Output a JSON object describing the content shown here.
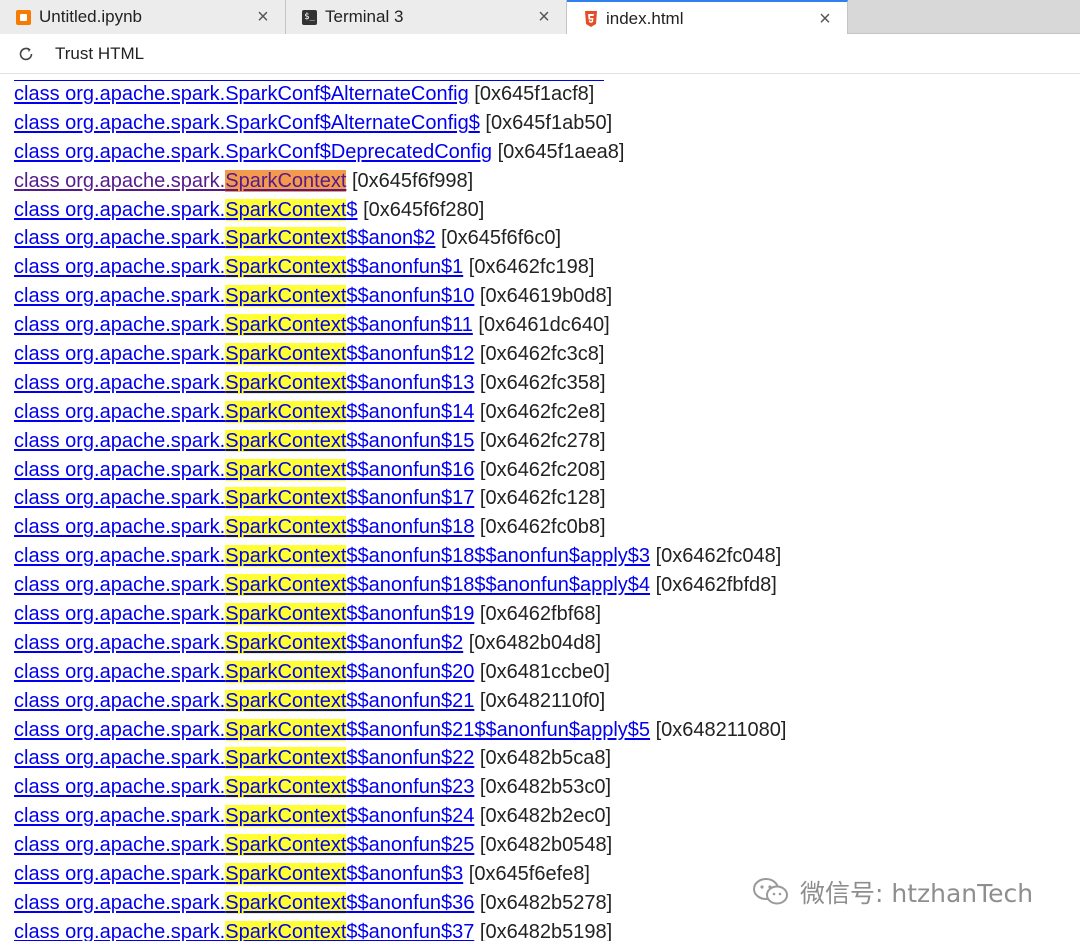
{
  "tabs": [
    {
      "label": "Untitled.ipynb",
      "icon": "notebook-icon",
      "active": false
    },
    {
      "label": "Terminal 3",
      "icon": "terminal-icon",
      "active": false
    },
    {
      "label": "index.html",
      "icon": "html-file-icon",
      "active": true
    }
  ],
  "tab_close_glyph": "×",
  "terminal_icon_glyph": "$_",
  "toolbar": {
    "trust_label": "Trust HTML"
  },
  "rows": [
    {
      "prefix": "class org.apache.spark.SparkConf$AlternateConfig",
      "hl": "",
      "suffix": "",
      "addr": " [0x645f1acf8]"
    },
    {
      "prefix": "class org.apache.spark.SparkConf$AlternateConfig$",
      "hl": "",
      "suffix": "",
      "addr": " [0x645f1ab50]"
    },
    {
      "prefix": "class org.apache.spark.SparkConf$DeprecatedConfig",
      "hl": "",
      "suffix": "",
      "addr": " [0x645f1aea8]"
    },
    {
      "prefix": "class org.apache.spark.",
      "hl": "SparkContext",
      "suffix": "",
      "addr": " [0x645f6f998]",
      "current": true,
      "visited": true
    },
    {
      "prefix": "class org.apache.spark.",
      "hl": "SparkContext",
      "suffix": "$",
      "addr": " [0x645f6f280]"
    },
    {
      "prefix": "class org.apache.spark.",
      "hl": "SparkContext",
      "suffix": "$$anon$2",
      "addr": " [0x645f6f6c0]"
    },
    {
      "prefix": "class org.apache.spark.",
      "hl": "SparkContext",
      "suffix": "$$anonfun$1",
      "addr": " [0x6462fc198]"
    },
    {
      "prefix": "class org.apache.spark.",
      "hl": "SparkContext",
      "suffix": "$$anonfun$10",
      "addr": " [0x64619b0d8]"
    },
    {
      "prefix": "class org.apache.spark.",
      "hl": "SparkContext",
      "suffix": "$$anonfun$11",
      "addr": " [0x6461dc640]"
    },
    {
      "prefix": "class org.apache.spark.",
      "hl": "SparkContext",
      "suffix": "$$anonfun$12",
      "addr": " [0x6462fc3c8]"
    },
    {
      "prefix": "class org.apache.spark.",
      "hl": "SparkContext",
      "suffix": "$$anonfun$13",
      "addr": " [0x6462fc358]"
    },
    {
      "prefix": "class org.apache.spark.",
      "hl": "SparkContext",
      "suffix": "$$anonfun$14",
      "addr": " [0x6462fc2e8]"
    },
    {
      "prefix": "class org.apache.spark.",
      "hl": "SparkContext",
      "suffix": "$$anonfun$15",
      "addr": " [0x6462fc278]"
    },
    {
      "prefix": "class org.apache.spark.",
      "hl": "SparkContext",
      "suffix": "$$anonfun$16",
      "addr": " [0x6462fc208]"
    },
    {
      "prefix": "class org.apache.spark.",
      "hl": "SparkContext",
      "suffix": "$$anonfun$17",
      "addr": " [0x6462fc128]"
    },
    {
      "prefix": "class org.apache.spark.",
      "hl": "SparkContext",
      "suffix": "$$anonfun$18",
      "addr": " [0x6462fc0b8]"
    },
    {
      "prefix": "class org.apache.spark.",
      "hl": "SparkContext",
      "suffix": "$$anonfun$18$$anonfun$apply$3",
      "addr": " [0x6462fc048]"
    },
    {
      "prefix": "class org.apache.spark.",
      "hl": "SparkContext",
      "suffix": "$$anonfun$18$$anonfun$apply$4",
      "addr": " [0x6462fbfd8]"
    },
    {
      "prefix": "class org.apache.spark.",
      "hl": "SparkContext",
      "suffix": "$$anonfun$19",
      "addr": " [0x6462fbf68]"
    },
    {
      "prefix": "class org.apache.spark.",
      "hl": "SparkContext",
      "suffix": "$$anonfun$2",
      "addr": " [0x6482b04d8]"
    },
    {
      "prefix": "class org.apache.spark.",
      "hl": "SparkContext",
      "suffix": "$$anonfun$20",
      "addr": " [0x6481ccbe0]"
    },
    {
      "prefix": "class org.apache.spark.",
      "hl": "SparkContext",
      "suffix": "$$anonfun$21",
      "addr": " [0x6482110f0]"
    },
    {
      "prefix": "class org.apache.spark.",
      "hl": "SparkContext",
      "suffix": "$$anonfun$21$$anonfun$apply$5",
      "addr": " [0x648211080]"
    },
    {
      "prefix": "class org.apache.spark.",
      "hl": "SparkContext",
      "suffix": "$$anonfun$22",
      "addr": " [0x6482b5ca8]"
    },
    {
      "prefix": "class org.apache.spark.",
      "hl": "SparkContext",
      "suffix": "$$anonfun$23",
      "addr": " [0x6482b53c0]"
    },
    {
      "prefix": "class org.apache.spark.",
      "hl": "SparkContext",
      "suffix": "$$anonfun$24",
      "addr": " [0x6482b2ec0]"
    },
    {
      "prefix": "class org.apache.spark.",
      "hl": "SparkContext",
      "suffix": "$$anonfun$25",
      "addr": " [0x6482b0548]"
    },
    {
      "prefix": "class org.apache.spark.",
      "hl": "SparkContext",
      "suffix": "$$anonfun$3",
      "addr": " [0x645f6efe8]"
    },
    {
      "prefix": "class org.apache.spark.",
      "hl": "SparkContext",
      "suffix": "$$anonfun$36",
      "addr": " [0x6482b5278]"
    },
    {
      "prefix": "class org.apache.spark.",
      "hl": "SparkContext",
      "suffix": "$$anonfun$37",
      "addr": " [0x6482b5198]"
    }
  ],
  "watermark": {
    "text": "微信号: htzhanTech",
    "icon": "wechat-icon"
  },
  "colors": {
    "link": "#0000ee",
    "visited": "#551a8b",
    "highlight": "#ffff33",
    "current_match": "#f39a4e",
    "tab_accent": "#2f80ed"
  }
}
